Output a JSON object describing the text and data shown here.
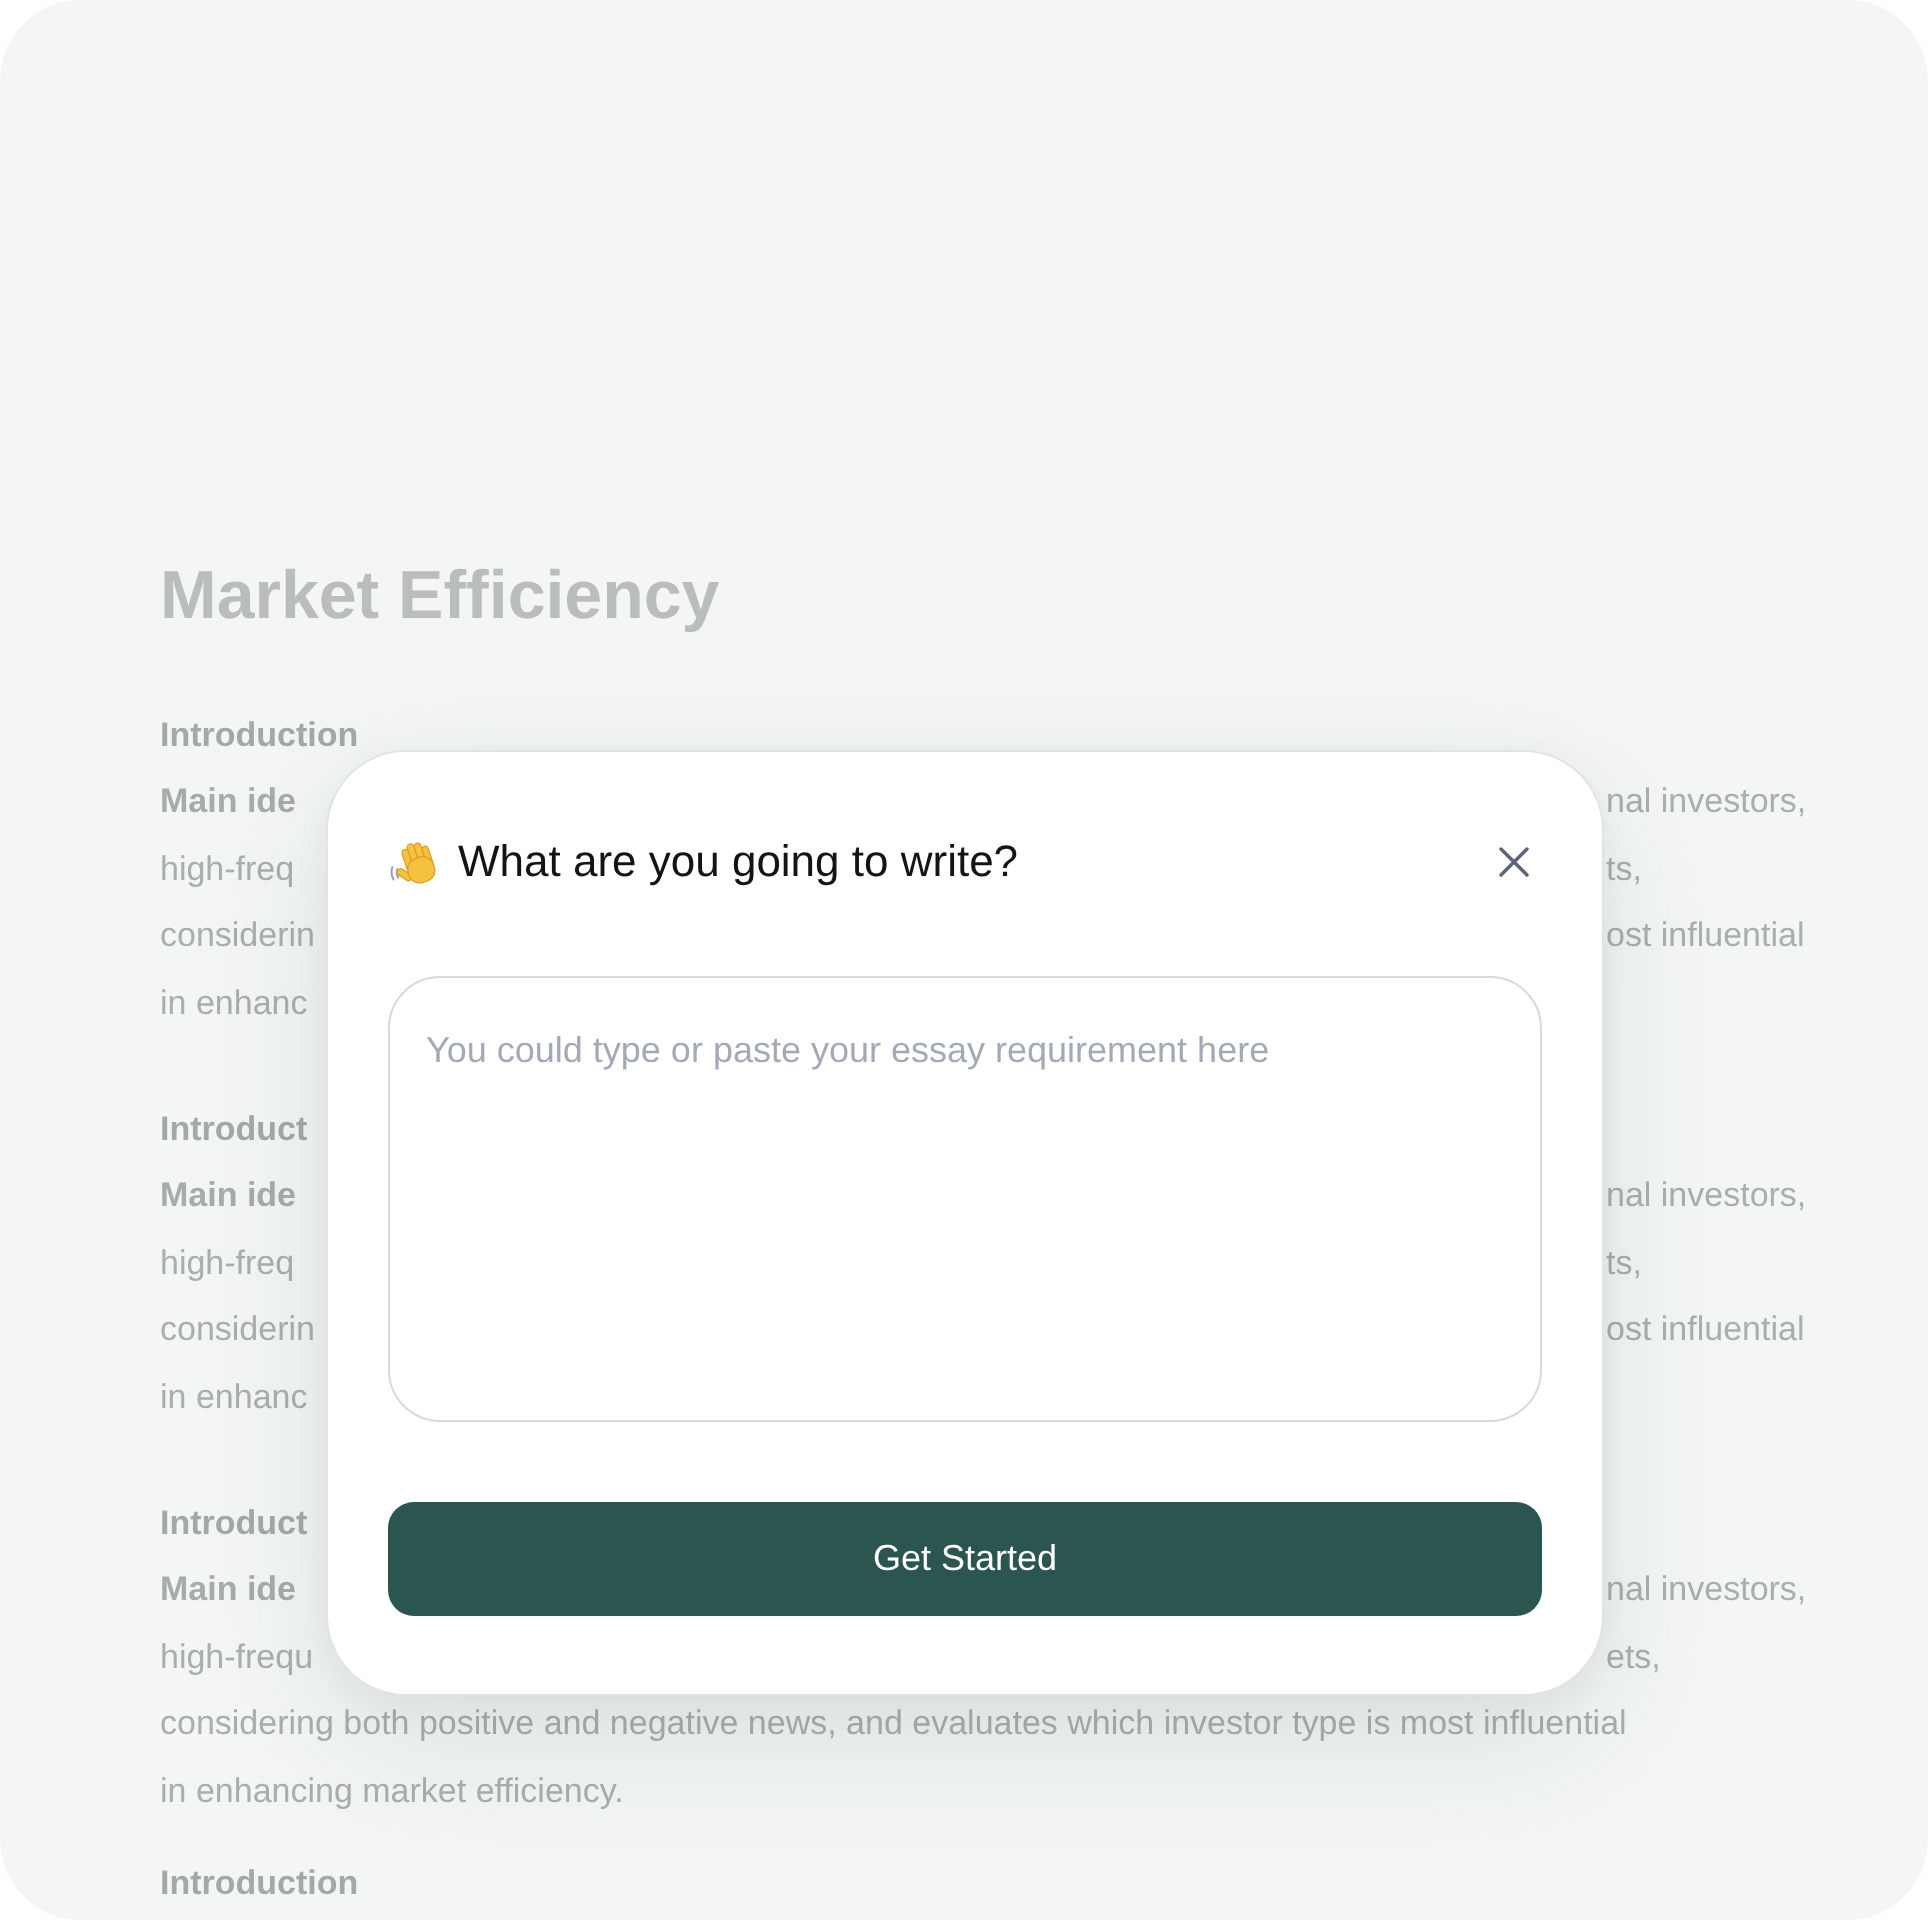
{
  "document": {
    "title": "Market Efficiency",
    "sections": [
      {
        "lines": [
          {
            "kind": "heading",
            "text": "Introduction"
          },
          {
            "kind": "main_idea",
            "start": "Main ide",
            "end": "nal investors,"
          },
          {
            "kind": "body",
            "start": "high-freq",
            "end": "ts,"
          },
          {
            "kind": "body",
            "start": "considerin",
            "end": "ost influential"
          },
          {
            "kind": "body",
            "start": "in enhanc"
          }
        ]
      },
      {
        "lines": [
          {
            "kind": "heading",
            "start": "Introduct"
          },
          {
            "kind": "main_idea",
            "start": "Main ide",
            "end": "nal investors,"
          },
          {
            "kind": "body",
            "start": "high-freq",
            "end": "ts,"
          },
          {
            "kind": "body",
            "start": "considerin",
            "end": "ost influential"
          },
          {
            "kind": "body",
            "start": "in enhanc"
          }
        ]
      },
      {
        "lines": [
          {
            "kind": "heading",
            "start": "Introduct"
          },
          {
            "kind": "main_idea",
            "start": "Main ide",
            "end": "nal investors,"
          },
          {
            "kind": "body",
            "start": "high-frequ",
            "end": "ets,"
          },
          {
            "kind": "body",
            "text": "considering both positive and negative news, and evaluates which investor type is most influential"
          },
          {
            "kind": "body",
            "text": "in enhancing market efficiency."
          }
        ]
      },
      {
        "lines": [
          {
            "kind": "heading",
            "text": "Introduction"
          }
        ]
      }
    ]
  },
  "dialog": {
    "title": "What are you going to write?",
    "field": {
      "placeholder": "You could type or paste your essay requirement here"
    },
    "button": "Get Started"
  }
}
